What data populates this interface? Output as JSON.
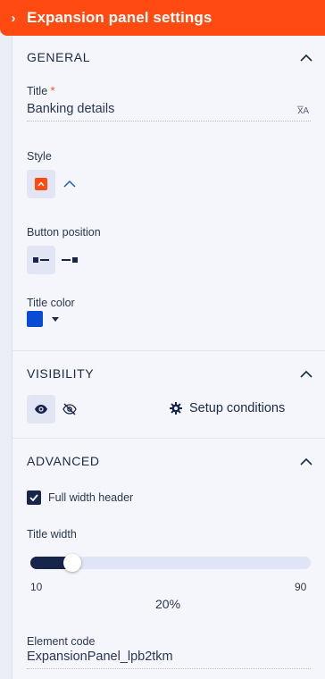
{
  "header": {
    "title": "Expansion panel settings"
  },
  "general": {
    "section_title": "GENERAL",
    "title_label": "Title",
    "required_mark": "*",
    "title_value": "Banking details",
    "style_label": "Style",
    "button_position_label": "Button position",
    "title_color_label": "Title color",
    "title_color": "#0a4bd6"
  },
  "visibility": {
    "section_title": "VISIBILITY",
    "setup_label": "Setup conditions"
  },
  "advanced": {
    "section_title": "ADVANCED",
    "full_width_label": "Full width header",
    "full_width_checked": true,
    "title_width_label": "Title width",
    "slider_min": "10",
    "slider_max": "90",
    "slider_value": "20%",
    "element_code_label": "Element code",
    "element_code_value": "ExpansionPanel_lpb2tkm"
  },
  "colors": {
    "accent": "#ff4a11",
    "dark": "#17254a",
    "selected_bg": "#e2e6f4"
  }
}
